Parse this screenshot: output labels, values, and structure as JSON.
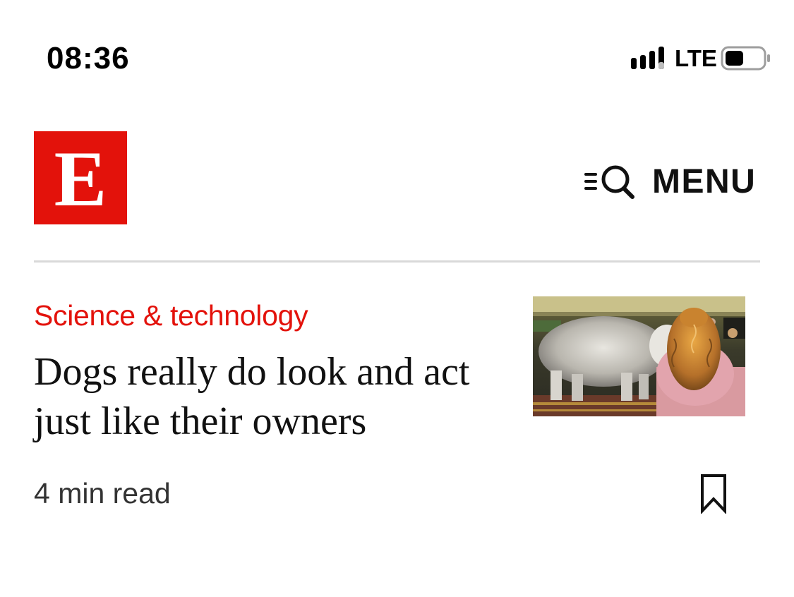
{
  "status_bar": {
    "time": "08:36",
    "network": "LTE",
    "icons": [
      "signal-icon",
      "battery-icon"
    ]
  },
  "header": {
    "logo_letter": "E",
    "menu_label": "MENU",
    "menu_icon": "search-menu-icon",
    "brand_color": "#e3120b"
  },
  "article": {
    "section": "Science & technology",
    "headline": "Dogs really do look and act just like their owners",
    "read_time": "4 min read",
    "thumbnail": "photo of a shaggy dog and a curly-haired woman at a dog show",
    "bookmark_icon": "bookmark-icon"
  }
}
